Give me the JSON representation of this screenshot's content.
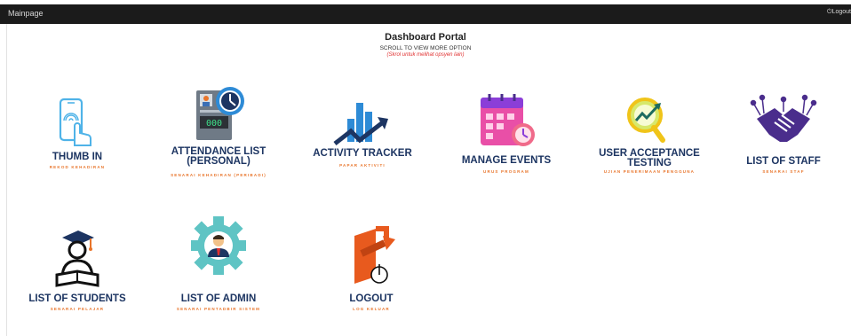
{
  "nav": {
    "brand": "Mainpage",
    "logout": "Logout",
    "logout_icon": "power-icon"
  },
  "header": {
    "title": "Dashboard Portal",
    "subtitle": "SCROLL TO VIEW MORE OPTION",
    "subtitle_ms": "(Skrol untuk melihat opsyen lain)"
  },
  "tiles": [
    {
      "label": "THUMB IN",
      "sublabel": "REKOD KEHADIRAN",
      "icon": "fingerprint-phone-icon"
    },
    {
      "label": "ATTENDANCE LIST (PERSONAL)",
      "sublabel": "SENARAI KEHADIRAN (PERIBADI)",
      "icon": "time-clock-icon"
    },
    {
      "label": "ACTIVITY TRACKER",
      "sublabel": "PAPAR AKTIVITI",
      "icon": "bar-chart-arrow-icon"
    },
    {
      "label": "MANAGE EVENTS",
      "sublabel": "URUS PROGRAM",
      "icon": "calendar-clock-icon"
    },
    {
      "label": "USER ACCEPTANCE TESTING",
      "sublabel": "UJIAN PENERIMAAN PENGGUNA",
      "icon": "magnifier-chart-icon"
    },
    {
      "label": "LIST OF STAFF",
      "sublabel": "SENARAI STAF",
      "icon": "handshake-icon"
    },
    {
      "label": "LIST OF STUDENTS",
      "sublabel": "SENARAI PELAJAR",
      "icon": "graduate-reading-icon"
    },
    {
      "label": "LIST OF ADMIN",
      "sublabel": "SENARAI PENTADBIR SISTEM",
      "icon": "admin-gear-icon"
    },
    {
      "label": "LOGOUT",
      "sublabel": "LOG KELUAR",
      "icon": "exit-power-icon"
    }
  ],
  "colors": {
    "topbar": "#1b1b1b",
    "label": "#1d3562",
    "sublabel": "#e8742a",
    "accent_blue": "#2e8bd6",
    "accent_teal": "#5fc4c4",
    "accent_purple": "#4a2d8c",
    "accent_pink": "#e94fa7"
  }
}
